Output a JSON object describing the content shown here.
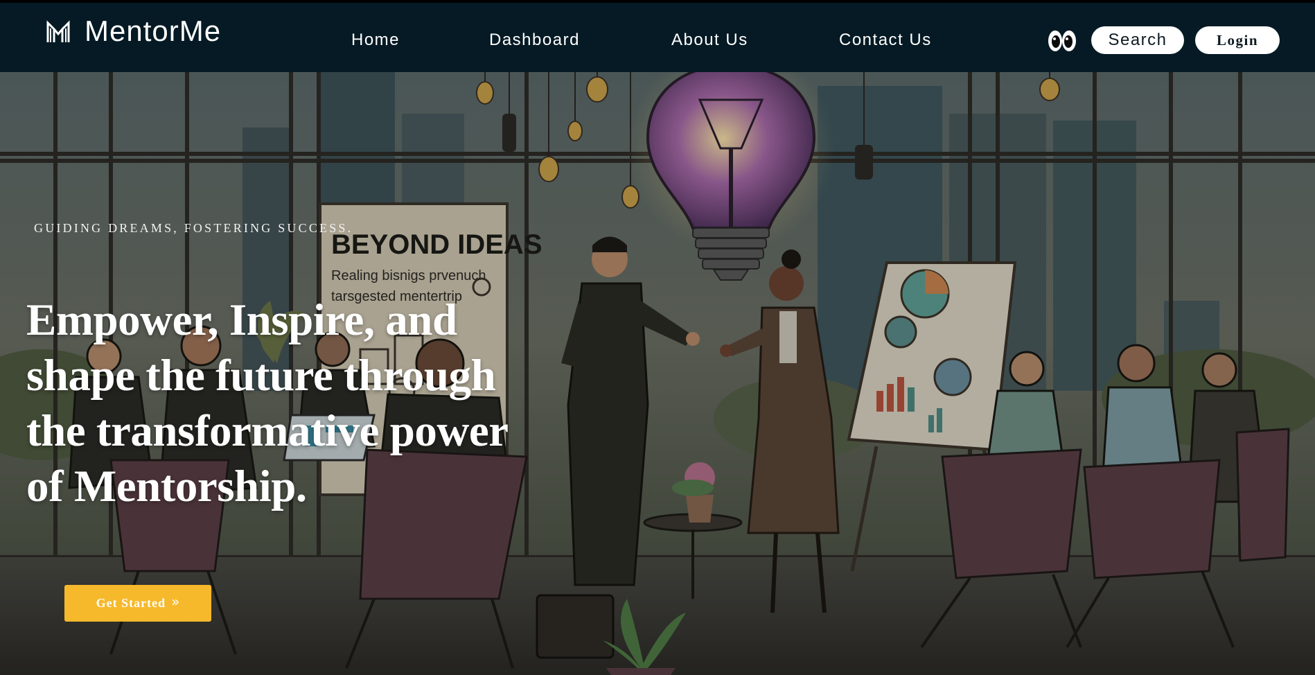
{
  "navbar": {
    "brand_name": "MentorMe",
    "brand_icon": "m-logo-icon",
    "links": [
      {
        "label": "Home"
      },
      {
        "label": "Dashboard"
      },
      {
        "label": "About Us"
      },
      {
        "label": "Contact Us"
      }
    ],
    "eyes_icon": "eyes-icon",
    "search_label": "Search",
    "login_label": "Login"
  },
  "hero": {
    "tagline": "GUIDING DREAMS, FOSTERING SUCCESS.",
    "heading": "Empower, Inspire, and shape the future through the transformative power of Mentorship.",
    "cta_label": "Get Started",
    "cta_icon": "double-chevron-right-icon",
    "cta_icon_glyph": "»",
    "poster_line_1": "BEYOND  IDEAS",
    "poster_line_2": "Realing bisnigs prvenuch",
    "poster_line_3": "tarsgested mentertrip"
  },
  "colors": {
    "navbar_bg": "#051a24",
    "cta_bg": "#f6b92b",
    "text_light": "#ffffff"
  }
}
